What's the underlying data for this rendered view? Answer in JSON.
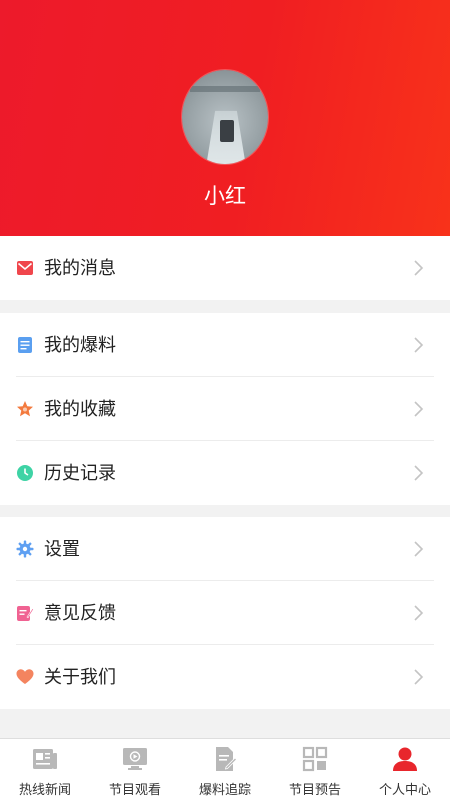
{
  "profile": {
    "username": "小红"
  },
  "menu": {
    "group1": [
      {
        "label": "我的消息",
        "icon": "envelope-icon"
      }
    ],
    "group2": [
      {
        "label": "我的爆料",
        "icon": "document-list-icon"
      },
      {
        "label": "我的收藏",
        "icon": "star-icon"
      },
      {
        "label": "历史记录",
        "icon": "clock-icon"
      }
    ],
    "group3": [
      {
        "label": "设置",
        "icon": "gear-icon"
      },
      {
        "label": "意见反馈",
        "icon": "feedback-icon"
      },
      {
        "label": "关于我们",
        "icon": "heart-icon"
      }
    ]
  },
  "tabbar": {
    "items": [
      {
        "label": "热线新闻",
        "icon": "newspaper-icon",
        "active": false
      },
      {
        "label": "节目观看",
        "icon": "monitor-play-icon",
        "active": false
      },
      {
        "label": "爆料追踪",
        "icon": "edit-document-icon",
        "active": false
      },
      {
        "label": "节目预告",
        "icon": "grid-icon",
        "active": false
      },
      {
        "label": "个人中心",
        "icon": "person-icon",
        "active": true
      }
    ]
  },
  "colors": {
    "header_red": "#ef1c27",
    "active_tab": "#e8262c",
    "inactive_tab": "#b8b8b8"
  }
}
